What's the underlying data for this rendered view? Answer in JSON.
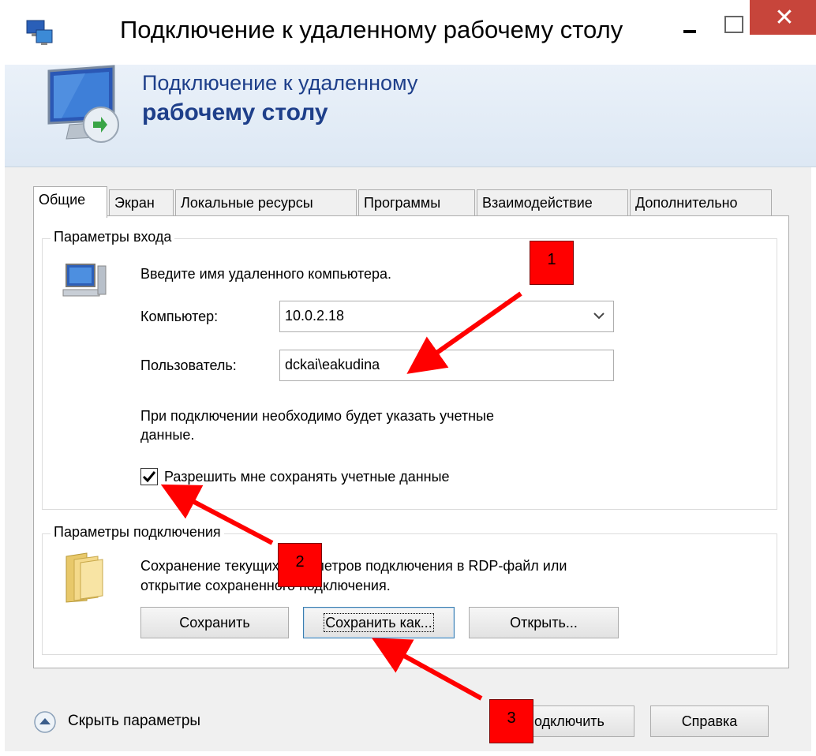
{
  "window": {
    "title": "Подключение к удаленному рабочему столу",
    "close_glyph": "✕"
  },
  "banner": {
    "line1": "Подключение к удаленному",
    "line2": "рабочему столу"
  },
  "tabs": [
    {
      "label": "Общие",
      "active": true
    },
    {
      "label": "Экран"
    },
    {
      "label": "Локальные ресурсы"
    },
    {
      "label": "Программы"
    },
    {
      "label": "Взаимодействие"
    },
    {
      "label": "Дополнительно"
    }
  ],
  "login": {
    "group_title": "Параметры входа",
    "hint": "Введите имя удаленного компьютера.",
    "computer_label": "Компьютер:",
    "computer_value": "10.0.2.18",
    "user_label": "Пользователь:",
    "user_value": "dckai\\eakudina",
    "note_line1": "При подключении необходимо будет указать учетные",
    "note_line2": "данные.",
    "save_creds_label": "Разрешить мне сохранять учетные данные",
    "save_creds_checked": true
  },
  "connection": {
    "group_title": "Параметры подключения",
    "desc_line1": "Сохранение текущих параметров подключения в RDP-файл или",
    "desc_line2": "открытие сохраненного подключения.",
    "save_label": "Сохранить",
    "save_as_label": "Сохранить как...",
    "open_label": "Открыть..."
  },
  "footer": {
    "hide_label": "Скрыть параметры",
    "connect_label": "Подключить",
    "help_label": "Справка"
  },
  "annotations": {
    "badge1": "1",
    "badge2": "2",
    "badge3": "3",
    "color": "#ff0000"
  },
  "icons": {
    "app": "remote-desktop-icon",
    "banner": "monitor-remote-icon",
    "computer": "computer-icon",
    "folder": "folder-icon",
    "dropdown": "chevron-down-icon",
    "toggle": "chevron-up-circle-icon"
  }
}
